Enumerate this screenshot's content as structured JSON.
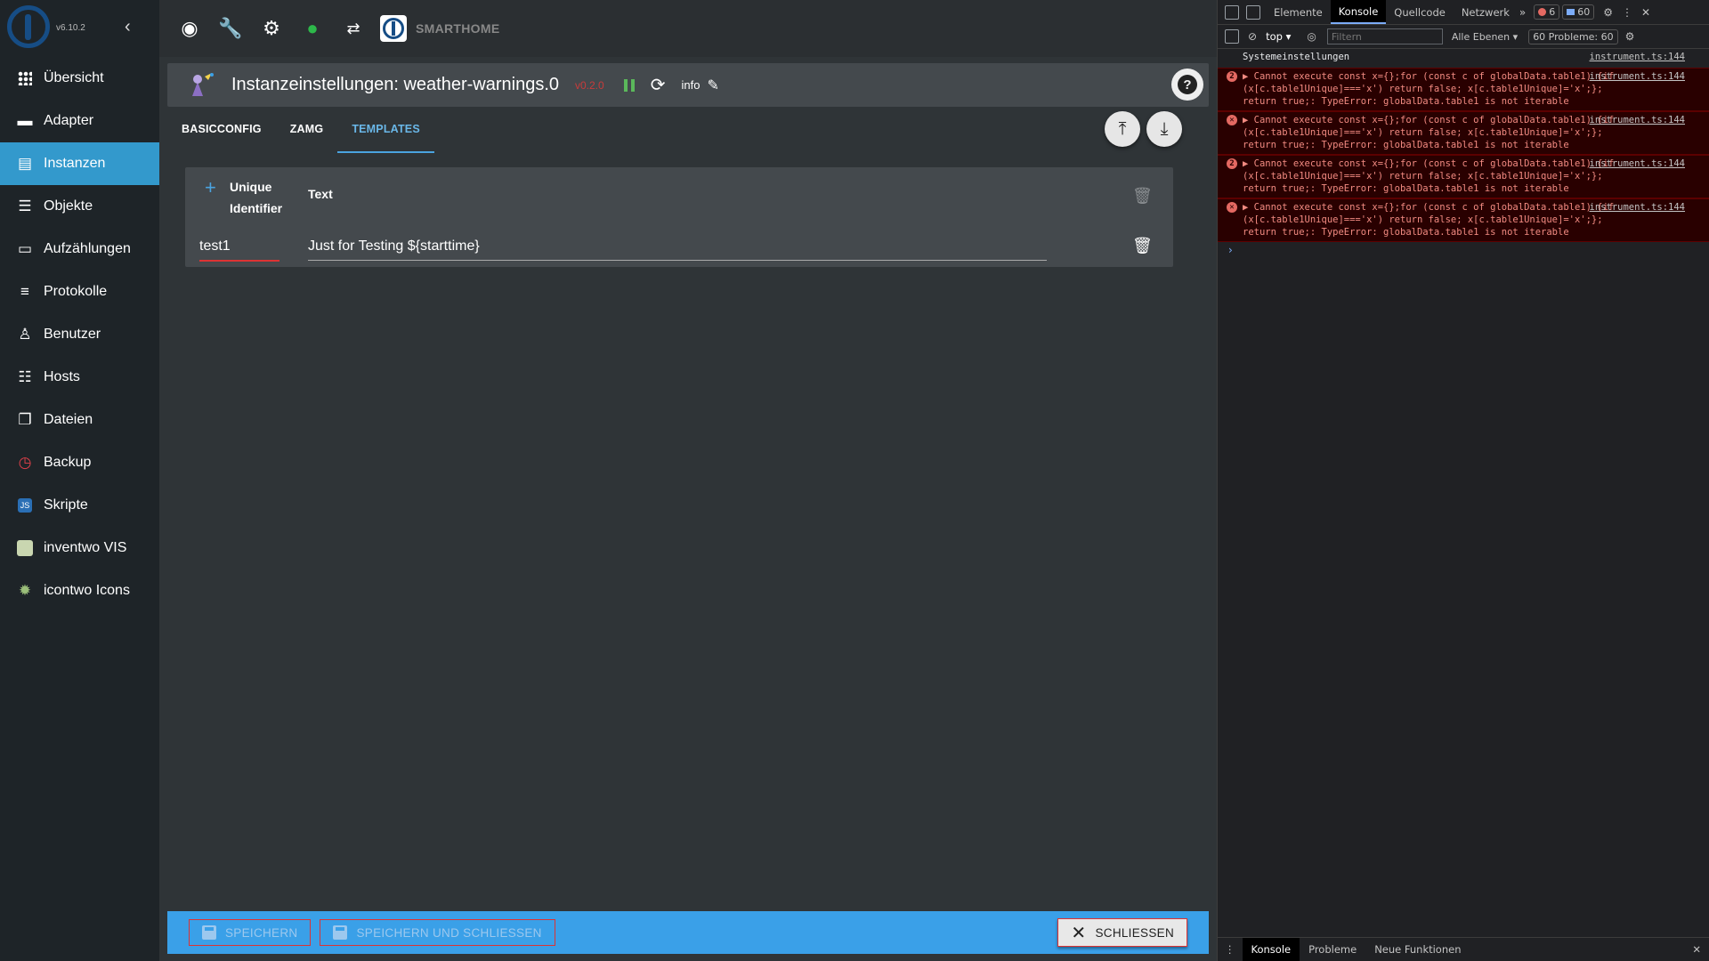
{
  "sidebar": {
    "version": "v6.10.2",
    "items": [
      {
        "label": "Übersicht",
        "icon": "grid-icon"
      },
      {
        "label": "Adapter",
        "icon": "store-icon"
      },
      {
        "label": "Instanzen",
        "icon": "instances-icon",
        "active": true
      },
      {
        "label": "Objekte",
        "icon": "list-icon"
      },
      {
        "label": "Aufzählungen",
        "icon": "enum-icon"
      },
      {
        "label": "Protokolle",
        "icon": "log-icon"
      },
      {
        "label": "Benutzer",
        "icon": "user-icon"
      },
      {
        "label": "Hosts",
        "icon": "hosts-icon"
      },
      {
        "label": "Dateien",
        "icon": "files-icon"
      },
      {
        "label": "Backup",
        "icon": "backup-icon"
      },
      {
        "label": "Skripte",
        "icon": "js-icon"
      },
      {
        "label": "inventwo VIS",
        "icon": "inventwo-icon"
      },
      {
        "label": "icontwo Icons",
        "icon": "icontwo-icon"
      }
    ]
  },
  "toolbar": {
    "brand": "SMARTHOME"
  },
  "instance": {
    "title": "Instanzeinstellungen: weather-warnings.0",
    "version": "v0.2.0",
    "info_label": "info"
  },
  "tabs": [
    "BASICCONFIG",
    "ZAMG",
    "TEMPLATES"
  ],
  "table": {
    "header_uid": "Unique Identifier",
    "header_text": "Text",
    "rows": [
      {
        "uid": "test1",
        "text": "Just for Testing ${starttime}"
      }
    ]
  },
  "actions": {
    "save": "SPEICHERN",
    "save_close": "SPEICHERN UND SCHLIESSEN",
    "close": "SCHLIESSEN"
  },
  "devtools": {
    "tabs": [
      "Elemente",
      "Konsole",
      "Quellcode",
      "Netzwerk"
    ],
    "error_count": "6",
    "info_count": "60",
    "context": "top",
    "filter_placeholder": "Filtern",
    "levels": "Alle Ebenen",
    "problems": "60 Probleme: ",
    "problems_count": "60",
    "logs": [
      {
        "type": "info",
        "msg": "Systemeinstellungen",
        "src": "instrument.ts:144"
      },
      {
        "type": "err",
        "count": "2",
        "msg": "▶ Cannot execute const x={};for (const c of globalData.table1) {if (x[c.table1Unique]==='x') return false; x[c.table1Unique]='x';}; return true;: TypeError: globalData.table1 is not iterable",
        "src": "instrument.ts:144"
      },
      {
        "type": "err",
        "msg": "▶ Cannot execute const x={};for (const c of globalData.table1) {if (x[c.table1Unique]==='x') return false; x[c.table1Unique]='x';}; return true;: TypeError: globalData.table1 is not iterable",
        "src": "instrument.ts:144"
      },
      {
        "type": "err",
        "count": "2",
        "msg": "▶ Cannot execute const x={};for (const c of globalData.table1) {if (x[c.table1Unique]==='x') return false; x[c.table1Unique]='x';}; return true;: TypeError: globalData.table1 is not iterable",
        "src": "instrument.ts:144"
      },
      {
        "type": "err",
        "msg": "▶ Cannot execute const x={};for (const c of globalData.table1) {if (x[c.table1Unique]==='x') return false; x[c.table1Unique]='x';}; return true;: TypeError: globalData.table1 is not iterable",
        "src": "instrument.ts:144"
      }
    ],
    "drawer_tabs": [
      "Konsole",
      "Probleme",
      "Neue Funktionen"
    ]
  }
}
